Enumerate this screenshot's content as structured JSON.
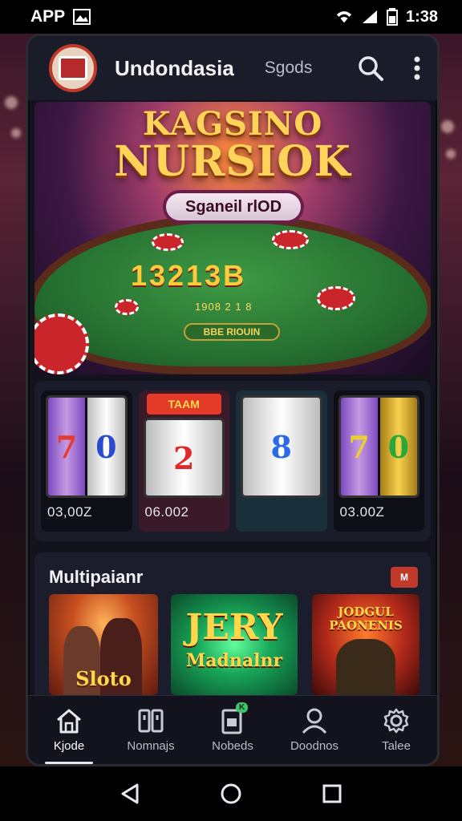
{
  "status_bar": {
    "app_label": "APP",
    "time": "1:38"
  },
  "header": {
    "title": "Undondasia",
    "link": "Sgods"
  },
  "banner": {
    "title_line1": "KAGSINO",
    "title_line2": "NURSIOK",
    "pill_label": "Sganeil rlOD",
    "numbers": "13213B",
    "small_numbers": "1908 2 1 8",
    "table_button": "BBE RIOUIN"
  },
  "slots": [
    {
      "symbols": [
        "7",
        "0"
      ],
      "value": "03,00Z"
    },
    {
      "banner": "TAAM",
      "symbols": [
        "2"
      ],
      "value": "06.002"
    },
    {
      "symbols": [
        "8"
      ],
      "value": ""
    },
    {
      "symbols": [
        "7",
        "0"
      ],
      "value": "03.00Z"
    }
  ],
  "multiplayer": {
    "title": "Multipaianr",
    "badge": "M",
    "games": [
      {
        "label": "Sloto"
      },
      {
        "label": "JERY",
        "sub": "Madnalnr"
      },
      {
        "label": "JODGUL PAONENIS"
      }
    ]
  },
  "bottom_nav": [
    {
      "label": "Kjode",
      "icon": "home-icon",
      "active": true
    },
    {
      "label": "Nomnajs",
      "icon": "cards-icon",
      "active": false
    },
    {
      "label": "Nobeds",
      "icon": "wallet-icon",
      "badge": "K",
      "active": false
    },
    {
      "label": "Doodnos",
      "icon": "profile-icon",
      "active": false
    },
    {
      "label": "Talee",
      "icon": "settings-icon",
      "active": false
    }
  ],
  "colors": {
    "accent": "#c0392b",
    "gold": "#ffd35a",
    "felt": "#2e8a3a",
    "background": "#12131d"
  }
}
